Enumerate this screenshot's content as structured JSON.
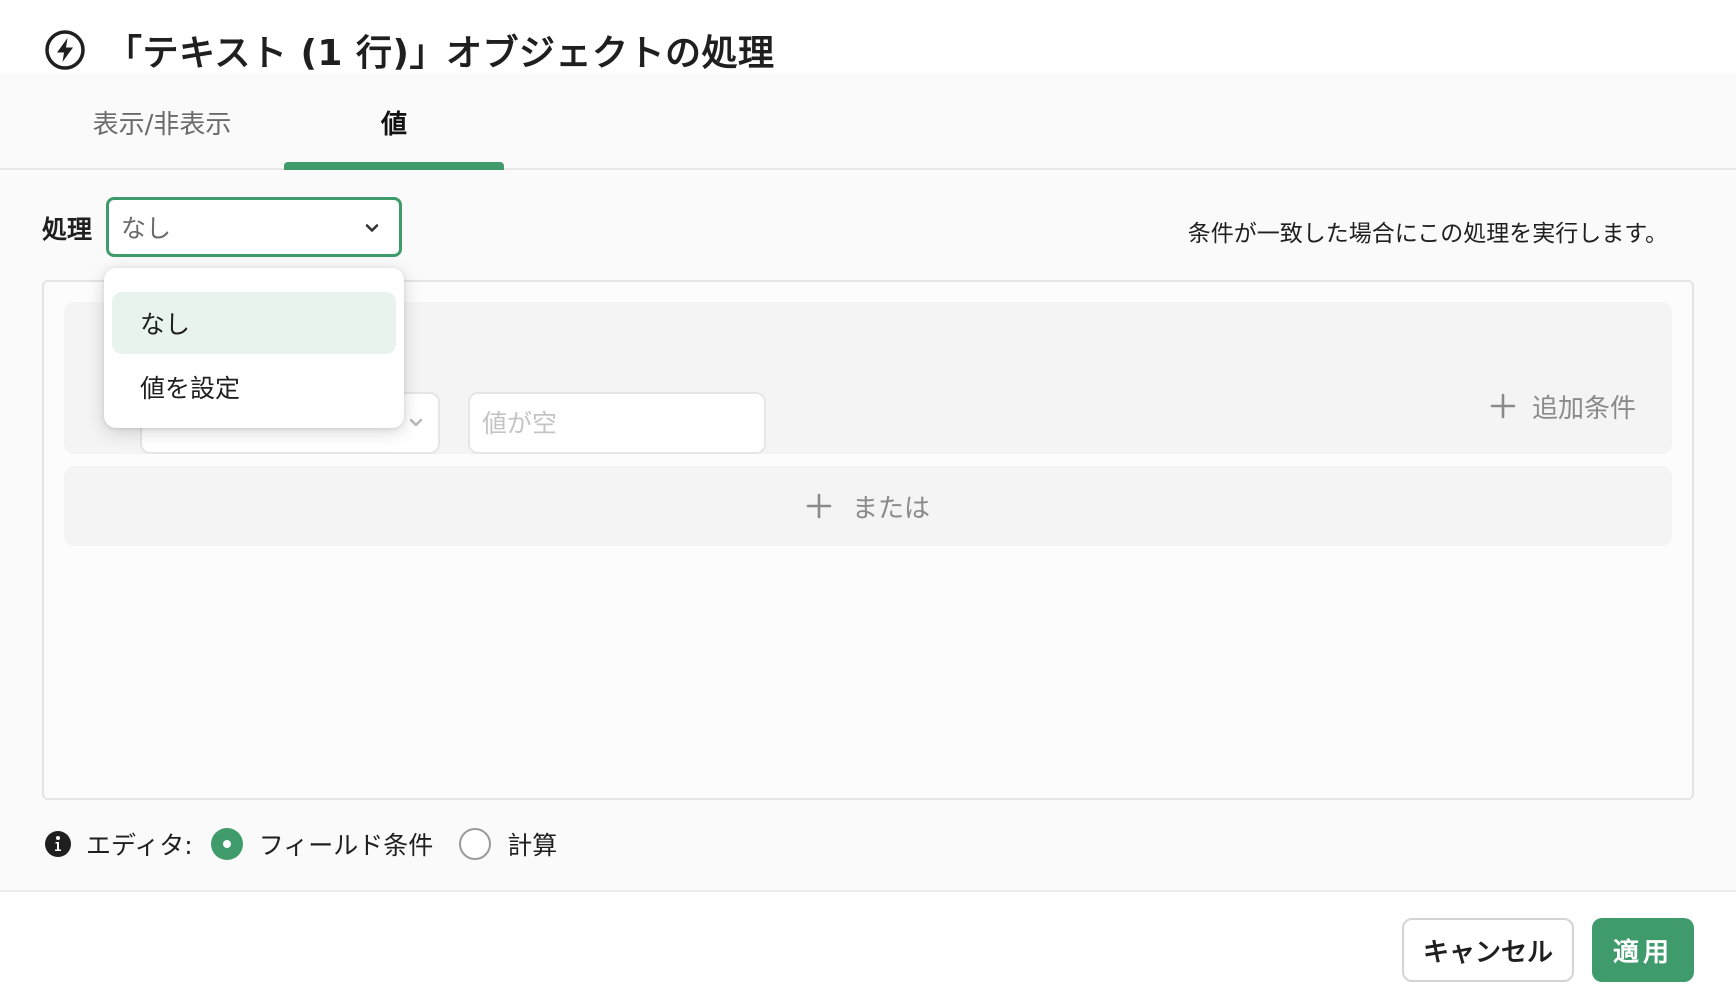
{
  "header": {
    "icon": "lightning-bolt-icon",
    "title": "「テキスト (1 行)」オブジェクトの処理"
  },
  "tabs": [
    {
      "label": "表示/非表示",
      "active": false
    },
    {
      "label": "値",
      "active": true
    }
  ],
  "action": {
    "label": "処理",
    "selected": "なし",
    "description": "条件が一致した場合にこの処理を実行します。",
    "options": [
      "なし",
      "値を設定"
    ]
  },
  "conditions": {
    "value_placeholder": "値が空",
    "add_condition_label": "追加条件",
    "or_label": "または"
  },
  "editor": {
    "label": "エディタ:",
    "options": [
      {
        "label": "フィールド条件",
        "checked": true
      },
      {
        "label": "計算",
        "checked": false
      }
    ]
  },
  "footer": {
    "cancel_label": "キャンセル",
    "apply_label": "適用"
  },
  "colors": {
    "accent": "#3f9b6c",
    "selected_option_bg": "#e9f3ee"
  }
}
